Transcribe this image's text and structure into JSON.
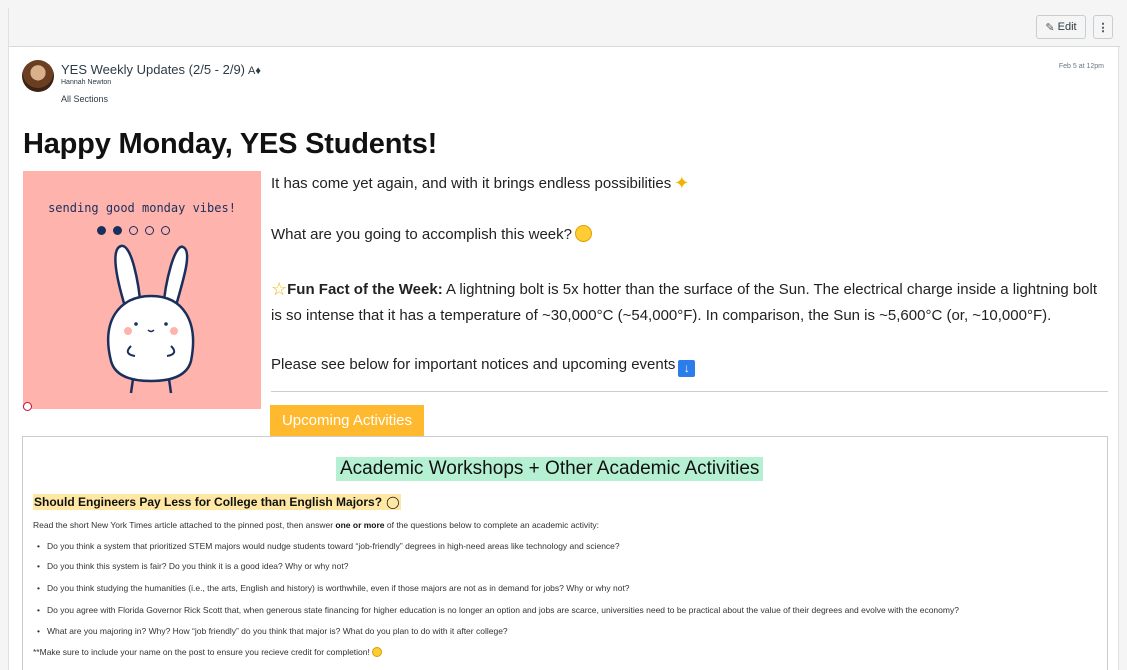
{
  "toolbar": {
    "edit_label": "Edit",
    "more_label": "⋮"
  },
  "post": {
    "title": "YES Weekly Updates (2/5 - 2/9)",
    "unread_icon": "A♦",
    "author": "Hannah Newton",
    "sections": "All Sections",
    "date": "Feb 5 at 12pm"
  },
  "body": {
    "heading": "Happy Monday, YES Students!",
    "image_caption": "sending good monday vibes!",
    "p1": "It has come yet again, and with it brings endless possibilities",
    "p2": "What are you going to accomplish this week?",
    "fun_fact_label": "Fun Fact of the Week:",
    "fun_fact": " A lightning bolt is 5x hotter than the surface of the Sun. The electrical charge inside a lightning bolt is so intense that it has a temperature of ~30,000°C (~54,000°F). In comparison, the Sun is ~5,600°C (or, ~10,000°F).",
    "p4": "Please see below for important notices and upcoming events",
    "tab_label": "Upcoming Activities"
  },
  "panel": {
    "title": "Academic Workshops + Other Academic Activities",
    "subheading": "Should Engineers Pay Less for College than English Majors?",
    "intro_pre": "Read the short New York Times article attached to the pinned post, then answer ",
    "intro_bold": "one or more",
    "intro_post": " of the questions below to complete an academic activity:",
    "questions": [
      "Do you think a system that prioritized STEM majors would nudge students toward “job-friendly” degrees in high-need areas like technology and science?",
      "Do you think this system is fair? Do you think it is a good idea? Why or why not?",
      "Do you think studying the humanities (i.e., the arts, English and history) is worthwhile, even if those majors are not as in demand for jobs? Why or why not?",
      "Do you agree with Florida Governor Rick Scott that, when generous state financing for higher education is no longer an option and jobs are scarce, universities need to be practical about the value of their degrees and evolve with the economy?",
      "What are you majoring in? Why? How “job friendly” do you think that major is? What do you plan to do with it after college?"
    ],
    "note": "**Make sure to include your name on the post to ensure you recieve credit for completion!"
  },
  "colors": {
    "tab": "#ffb92e",
    "panel_title_bg": "#b5f0d2",
    "subheading_bg": "#ffe8a3",
    "image_bg": "#ffb3ad"
  }
}
